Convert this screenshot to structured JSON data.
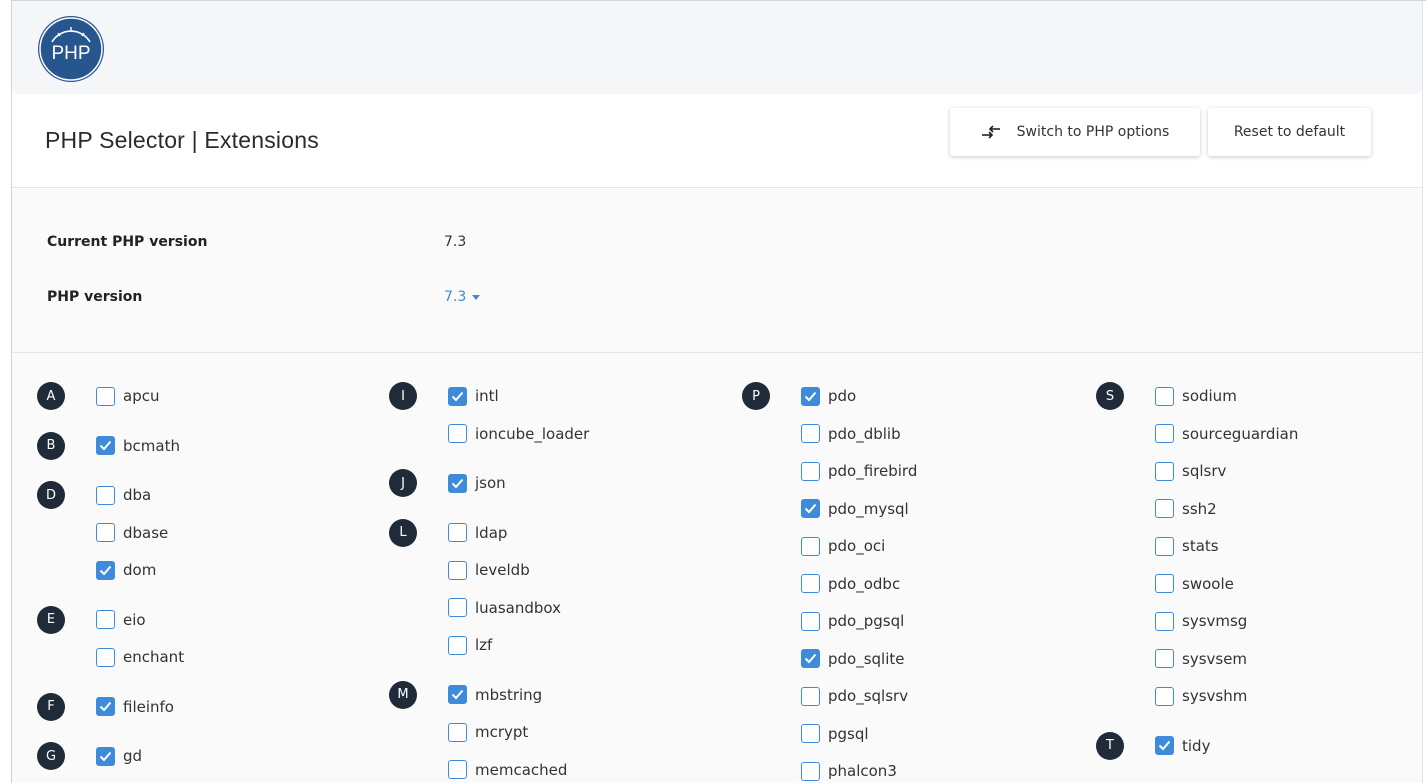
{
  "header": {
    "logo_text": "PHP",
    "title": "PHP Selector | Extensions",
    "switch_button": "Switch to PHP options",
    "reset_button": "Reset to default"
  },
  "info": {
    "current_label": "Current PHP version",
    "current_value": "7.3",
    "version_label": "PHP version",
    "version_value": "7.3"
  },
  "colors": {
    "accent": "#3d8bd9",
    "letter_badge": "#1f2b38",
    "logo": "#27558e"
  },
  "columns": [
    {
      "groups": [
        {
          "letter": "A",
          "items": [
            {
              "name": "apcu",
              "checked": false
            }
          ]
        },
        {
          "letter": "B",
          "items": [
            {
              "name": "bcmath",
              "checked": true
            }
          ]
        },
        {
          "letter": "D",
          "items": [
            {
              "name": "dba",
              "checked": false
            },
            {
              "name": "dbase",
              "checked": false
            },
            {
              "name": "dom",
              "checked": true
            }
          ]
        },
        {
          "letter": "E",
          "items": [
            {
              "name": "eio",
              "checked": false
            },
            {
              "name": "enchant",
              "checked": false
            }
          ]
        },
        {
          "letter": "F",
          "items": [
            {
              "name": "fileinfo",
              "checked": true
            }
          ]
        },
        {
          "letter": "G",
          "items": [
            {
              "name": "gd",
              "checked": true
            }
          ]
        }
      ]
    },
    {
      "groups": [
        {
          "letter": "I",
          "items": [
            {
              "name": "intl",
              "checked": true
            },
            {
              "name": "ioncube_loader",
              "checked": false
            }
          ]
        },
        {
          "letter": "J",
          "items": [
            {
              "name": "json",
              "checked": true
            }
          ]
        },
        {
          "letter": "L",
          "items": [
            {
              "name": "ldap",
              "checked": false
            },
            {
              "name": "leveldb",
              "checked": false
            },
            {
              "name": "luasandbox",
              "checked": false
            },
            {
              "name": "lzf",
              "checked": false
            }
          ]
        },
        {
          "letter": "M",
          "items": [
            {
              "name": "mbstring",
              "checked": true
            },
            {
              "name": "mcrypt",
              "checked": false
            },
            {
              "name": "memcached",
              "checked": false
            }
          ]
        }
      ]
    },
    {
      "groups": [
        {
          "letter": "P",
          "items": [
            {
              "name": "pdo",
              "checked": true
            },
            {
              "name": "pdo_dblib",
              "checked": false
            },
            {
              "name": "pdo_firebird",
              "checked": false
            },
            {
              "name": "pdo_mysql",
              "checked": true
            },
            {
              "name": "pdo_oci",
              "checked": false
            },
            {
              "name": "pdo_odbc",
              "checked": false
            },
            {
              "name": "pdo_pgsql",
              "checked": false
            },
            {
              "name": "pdo_sqlite",
              "checked": true
            },
            {
              "name": "pdo_sqlsrv",
              "checked": false
            },
            {
              "name": "pgsql",
              "checked": false
            },
            {
              "name": "phalcon3",
              "checked": false
            }
          ]
        }
      ]
    },
    {
      "groups": [
        {
          "letter": "S",
          "items": [
            {
              "name": "sodium",
              "checked": false
            },
            {
              "name": "sourceguardian",
              "checked": false
            },
            {
              "name": "sqlsrv",
              "checked": false
            },
            {
              "name": "ssh2",
              "checked": false
            },
            {
              "name": "stats",
              "checked": false
            },
            {
              "name": "swoole",
              "checked": false
            },
            {
              "name": "sysvmsg",
              "checked": false
            },
            {
              "name": "sysvsem",
              "checked": false
            },
            {
              "name": "sysvshm",
              "checked": false
            }
          ]
        },
        {
          "letter": "T",
          "items": [
            {
              "name": "tidy",
              "checked": true
            }
          ]
        }
      ]
    }
  ]
}
